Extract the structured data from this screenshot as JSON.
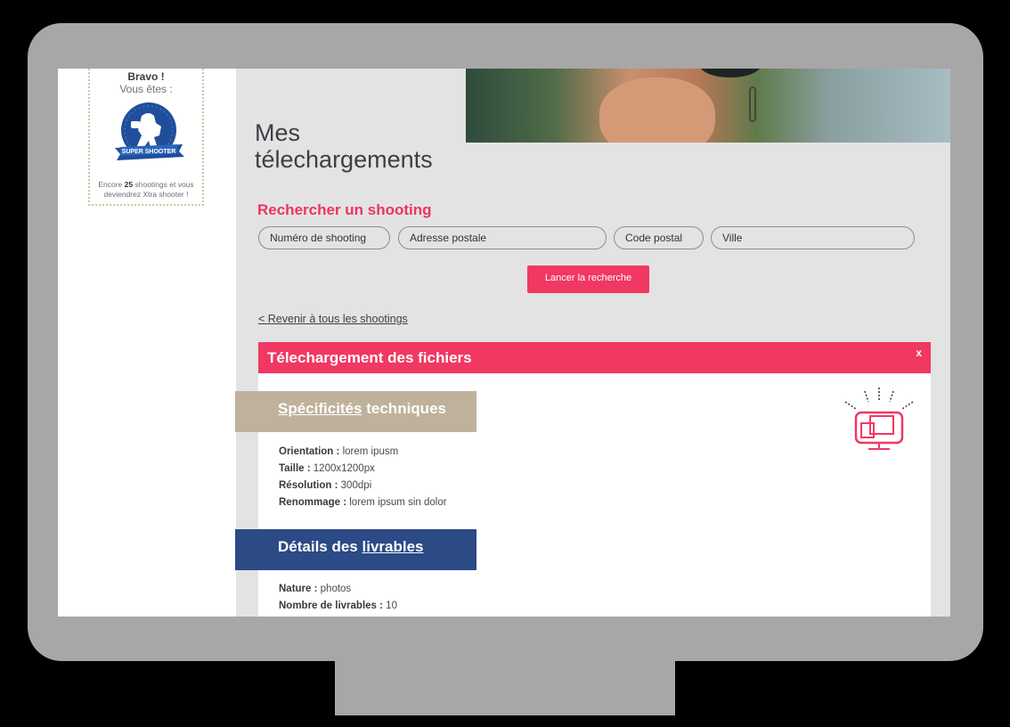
{
  "sidebar": {
    "badge": {
      "title": "Bravo !",
      "subtitle": "Vous êtes :",
      "ribbon": "SUPER SHOOTER",
      "encore_prefix": "Encore",
      "encore_count": "25",
      "encore_suffix": "shootings et vous deviendrez Xtra shooter !"
    }
  },
  "main": {
    "title": "Mes télechargements",
    "search": {
      "title": "Rechercher un shooting",
      "fields": {
        "numero": "Numéro de shooting",
        "adresse": "Adresse postale",
        "code": "Code postal",
        "ville": "Ville"
      },
      "button": "Lancer la recherche"
    },
    "back_link": "< Revenir à tous les shootings",
    "panel": {
      "title": "Télechargement des fichiers",
      "close": "x",
      "tech": {
        "title_link": "Spécificités",
        "title_rest": "techniques",
        "rows": [
          {
            "label": "Orientation :",
            "value": "lorem ipusm"
          },
          {
            "label": "Taille :",
            "value": "1200x1200px"
          },
          {
            "label": "Résolution :",
            "value": "300dpi"
          },
          {
            "label": "Renommage :",
            "value": "lorem ipsum sin dolor"
          }
        ]
      },
      "deliverables": {
        "title_pre": "Détails des",
        "title_link": "livrables",
        "rows": [
          {
            "label": "Nature :",
            "value": "photos"
          },
          {
            "label": "Nombre de livrables :",
            "value": "10"
          }
        ]
      }
    }
  },
  "colors": {
    "accent": "#f03862",
    "tech_band": "#bfb19b",
    "deliverables_band": "#2c4a86"
  },
  "icons": [
    "super-shooter-badge-icon",
    "monitor-download-icon"
  ]
}
